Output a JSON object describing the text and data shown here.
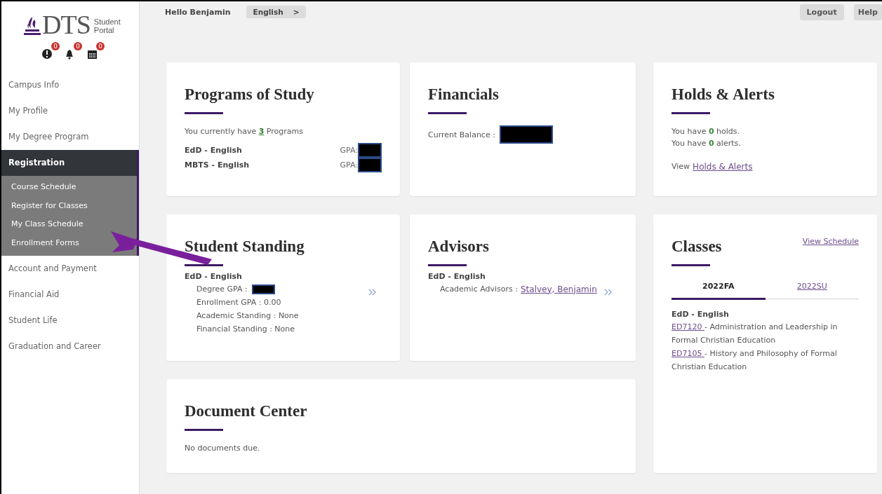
{
  "header": {
    "greeting": "Hello Benjamin",
    "language": "English",
    "language_caret": ">",
    "buttons": [
      "Logout",
      "Help"
    ]
  },
  "logo": {
    "mark": "DTS",
    "line_1": "Student",
    "line_2": "Portal"
  },
  "notifications": [
    {
      "kind": "alert",
      "count": "0"
    },
    {
      "kind": "bell",
      "count": "0"
    },
    {
      "kind": "calendar",
      "count": "0"
    }
  ],
  "sidebar": {
    "items": [
      {
        "label": "Campus Info",
        "selected": false
      },
      {
        "label": "My Profile",
        "selected": false
      },
      {
        "label": "My Degree Program",
        "selected": false
      },
      {
        "label": "Registration",
        "selected": true,
        "expanded": true,
        "children": [
          {
            "label": "Course Schedule"
          },
          {
            "label": "Register for Classes"
          },
          {
            "label": "My Class Schedule"
          },
          {
            "label": "Enrollment Forms"
          }
        ]
      },
      {
        "label": "Account and Payment",
        "selected": false
      },
      {
        "label": "Financial Aid",
        "selected": false
      },
      {
        "label": "Student Life",
        "selected": false
      },
      {
        "label": "Graduation and Career",
        "selected": false
      }
    ]
  },
  "programs": {
    "title": "Programs of Study",
    "prefix": "You currently have",
    "count": "3",
    "suffix": "Programs",
    "rows": [
      {
        "program": "EdD - English",
        "gpa_label": "GPA:",
        "redacted": true
      },
      {
        "program": "MBTS - English",
        "gpa_label": "GPA:",
        "redacted": true
      }
    ]
  },
  "financials": {
    "title": "Financials",
    "balance_label": "Current Balance :",
    "redacted": true
  },
  "holds": {
    "title": "Holds & Alerts",
    "lines": [
      {
        "prefix": "You have",
        "count": "0",
        "suffix": "holds."
      },
      {
        "prefix": "You have",
        "count": "0",
        "suffix": "alerts."
      }
    ],
    "view_prefix": "View",
    "view_link": "Holds & Alerts"
  },
  "standing": {
    "title": "Student Standing",
    "program": "EdD - English",
    "lines": [
      {
        "text": "Degree GPA :",
        "redacted": true
      },
      {
        "text": "Enrollment GPA : 0.00",
        "redacted": false
      },
      {
        "text": "Academic Standing : None",
        "redacted": false
      },
      {
        "text": "Financial Standing : None",
        "redacted": false
      }
    ]
  },
  "advisors": {
    "title": "Advisors",
    "program": "EdD - English",
    "label": "Academic Advisors :",
    "link": "Stalvey, Benjamin"
  },
  "classes": {
    "title": "Classes",
    "view_link": "View Schedule",
    "tabs": [
      {
        "label": "2022FA",
        "selected": true
      },
      {
        "label": "2022SU",
        "selected": false
      }
    ],
    "program": "EdD - English",
    "courses": [
      {
        "code": "ED7120",
        "title": "- Administration and Leadership in Formal Christian Education"
      },
      {
        "code": "ED7105",
        "title": "- History and Philosophy of Formal Christian Education"
      }
    ]
  },
  "documents": {
    "title": "Document Center",
    "text": "No documents due."
  }
}
